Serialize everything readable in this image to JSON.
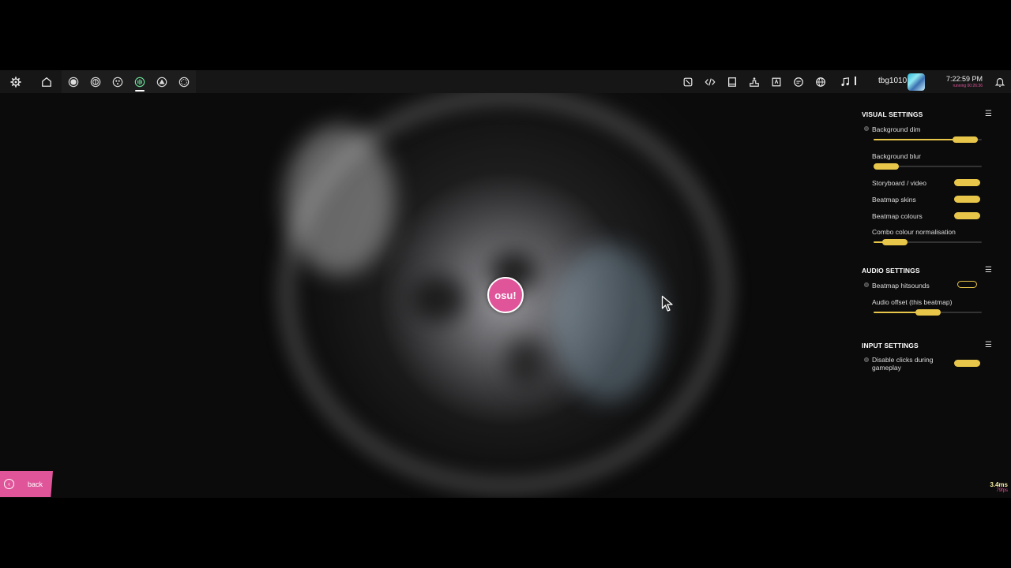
{
  "toolbar": {
    "username": "tbg1010",
    "clock": "7:22:59 PM",
    "runtime": "running 00:26:36"
  },
  "logo": {
    "text": "osu!"
  },
  "visual_settings": {
    "title": "VISUAL SETTINGS",
    "background_dim": {
      "label": "Background dim",
      "value": 0.85
    },
    "background_blur": {
      "label": "Background blur",
      "value": 0.12
    },
    "storyboard_video": {
      "label": "Storyboard / video",
      "enabled": true
    },
    "beatmap_skins": {
      "label": "Beatmap skins",
      "enabled": true
    },
    "beatmap_colours": {
      "label": "Beatmap colours",
      "enabled": true
    },
    "combo_colour_normalisation": {
      "label": "Combo colour normalisation",
      "value": 0.2
    }
  },
  "audio_settings": {
    "title": "AUDIO SETTINGS",
    "beatmap_hitsounds": {
      "label": "Beatmap hitsounds",
      "enabled": false
    },
    "audio_offset": {
      "label": "Audio offset (this beatmap)",
      "value": 0.5
    }
  },
  "input_settings": {
    "title": "INPUT SETTINGS",
    "disable_clicks": {
      "label": "Disable clicks during\ngameplay",
      "enabled": true
    }
  },
  "back": {
    "label": "back"
  },
  "stats": {
    "frametime": "3.4ms",
    "fps": "79fps"
  },
  "colors": {
    "accent": "#e7c64a",
    "pink": "#e0559a",
    "ruleset_active": "#6de39b"
  },
  "icons": {
    "toolbar_left": [
      "gear-icon",
      "home-icon"
    ],
    "rulesets": [
      "osu-ruleset-icon",
      "taiko-ruleset-icon",
      "catch-ruleset-icon",
      "mania-ruleset-icon",
      "ruleset-icon-5",
      "ruleset-icon-6"
    ],
    "toolbar_right": [
      "beatmap-listing-icon",
      "code-icon",
      "news-icon",
      "rankings-icon",
      "wiki-icon",
      "chat-icon",
      "globe-icon",
      "music-icon",
      "notifications-icon"
    ]
  }
}
